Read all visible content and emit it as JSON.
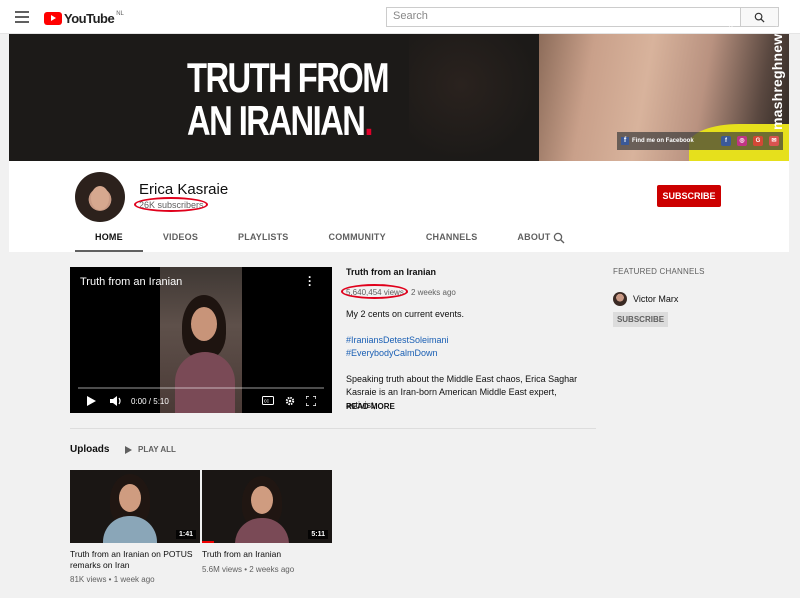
{
  "topbar": {
    "logo_text": "YouTube",
    "logo_country": "NL",
    "search_placeholder": "Search"
  },
  "banner": {
    "title_line1": "TRUTH FROM",
    "title_line2": "AN IRANIAN",
    "title_dot": ".",
    "social_label": "Find me on Facebook",
    "watermark": "mashreghnews"
  },
  "channel": {
    "name": "Erica Kasraie",
    "subscribers": "26K subscribers",
    "subscribe_label": "SUBSCRIBE",
    "tabs": [
      "HOME",
      "VIDEOS",
      "PLAYLISTS",
      "COMMUNITY",
      "CHANNELS",
      "ABOUT"
    ]
  },
  "featured_video": {
    "player_title": "Truth from an Iranian",
    "time": "0:00 / 5:10",
    "title": "Truth from an Iranian",
    "views": "5,640,454 views",
    "age": "2 weeks ago",
    "desc1": "My 2 cents on current events.",
    "hashtag1": "#IraniansDetestSoleimani",
    "hashtag2": "#EverybodyCalmDown",
    "desc2": "Speaking truth about the Middle East chaos, Erica Saghar Kasraie is an Iran-born American Middle East expert, activist,",
    "read_more": "READ MORE"
  },
  "featured_channels": {
    "title": "FEATURED CHANNELS",
    "channel_name": "Victor Marx",
    "subscribe_label": "SUBSCRIBE"
  },
  "uploads": {
    "title": "Uploads",
    "play_all": "PLAY ALL",
    "videos": [
      {
        "duration": "1:41",
        "title": "Truth from an Iranian on POTUS remarks on Iran",
        "meta": "81K views • 1 week ago"
      },
      {
        "duration": "5:11",
        "title": "Truth from an Iranian",
        "meta": "5.6M views • 2 weeks ago"
      }
    ]
  },
  "colors": {
    "accent_red": "#cc0000",
    "annotation_red": "#e0001b",
    "link_blue": "#1a5fb4"
  }
}
